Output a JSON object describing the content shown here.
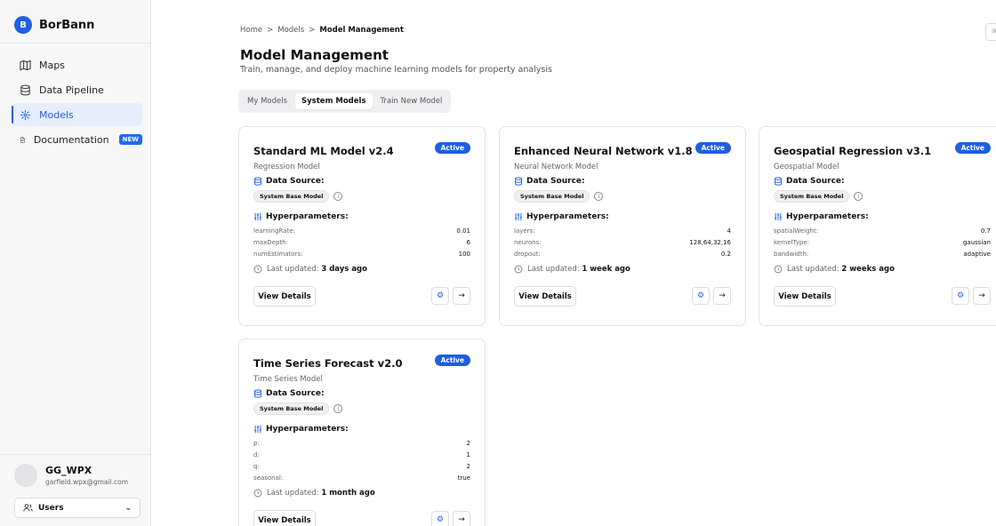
{
  "sidebar": {
    "logo_letter": "B",
    "brand": "BorBann",
    "items": [
      {
        "label": "Maps"
      },
      {
        "label": "Data Pipeline"
      },
      {
        "label": "Models"
      },
      {
        "label": "Documentation",
        "badge": "NEW"
      }
    ],
    "user": {
      "name": "GG_WPX",
      "email": "garfield.wpx@gmail.com"
    },
    "users_button": "Users"
  },
  "header": {
    "breadcrumb": [
      "Home",
      ">",
      "Models",
      ">",
      "Model Management"
    ],
    "title": "Model Management",
    "subtitle": "Train, manage, and deploy machine learning models for property analysis"
  },
  "tabs": [
    "My Models",
    "System Models",
    "Train New Model"
  ],
  "labels": {
    "data_source": "Data Source:",
    "hyperparameters": "Hyperparameters:",
    "last_updated": "Last updated:",
    "view_details": "View Details"
  },
  "cards": [
    {
      "title": "Standard ML Model v2.4",
      "status": "Active",
      "type": "Regression Model",
      "data_source": "System Base Model",
      "hyperparameters": [
        {
          "key": "learningRate:",
          "value": "0.01"
        },
        {
          "key": "maxDepth:",
          "value": "6"
        },
        {
          "key": "numEstimators:",
          "value": "100"
        }
      ],
      "updated": "3 days ago"
    },
    {
      "title": "Enhanced Neural Network v1.8",
      "status": "Active",
      "type": "Neural Network Model",
      "data_source": "System Base Model",
      "hyperparameters": [
        {
          "key": "layers:",
          "value": "4"
        },
        {
          "key": "neurons:",
          "value": "128,64,32,16"
        },
        {
          "key": "dropout:",
          "value": "0.2"
        }
      ],
      "updated": "1 week ago"
    },
    {
      "title": "Geospatial Regression v3.1",
      "status": "Active",
      "type": "Geospatial Model",
      "data_source": "System Base Model",
      "hyperparameters": [
        {
          "key": "spatialWeight:",
          "value": "0.7"
        },
        {
          "key": "kernelType:",
          "value": "gaussian"
        },
        {
          "key": "bandwidth:",
          "value": "adaptive"
        }
      ],
      "updated": "2 weeks ago"
    },
    {
      "title": "Time Series Forecast v2.0",
      "status": "Active",
      "type": "Time Series Model",
      "data_source": "System Base Model",
      "hyperparameters": [
        {
          "key": "p:",
          "value": "2"
        },
        {
          "key": "d:",
          "value": "1"
        },
        {
          "key": "q:",
          "value": "2"
        },
        {
          "key": "seasonal:",
          "value": "true"
        }
      ],
      "updated": "1 month ago"
    }
  ],
  "colors": {
    "accent": "#1f5fe0",
    "sidebar_bg": "#f7f7f8",
    "active_nav_bg": "#e6eefc"
  },
  "icons": [
    "map-icon",
    "database-icon",
    "models-icon",
    "document-icon",
    "users-icon",
    "chevron-down-icon",
    "settings-icon",
    "clock-icon",
    "info-icon",
    "sliders-icon",
    "gear-icon",
    "arrow-right-icon"
  ]
}
